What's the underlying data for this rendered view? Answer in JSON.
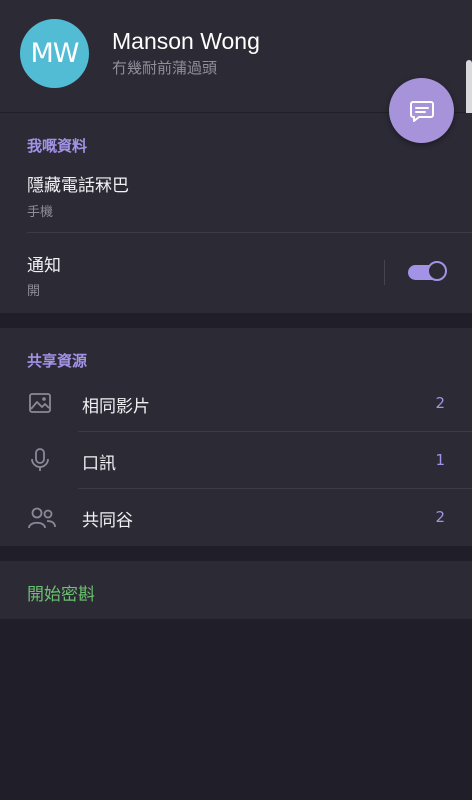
{
  "profile": {
    "initials": "MW",
    "name": "Manson Wong",
    "status": "冇幾耐前蒲過頭",
    "avatar_color": "#53bcd5"
  },
  "fab": {
    "icon": "message-icon",
    "color": "#a793d9"
  },
  "info": {
    "title": "我嘅資料",
    "phone": {
      "value": "隱藏電話冧巴",
      "label": "手機"
    },
    "notifications": {
      "label": "通知",
      "status": "開",
      "enabled": true
    }
  },
  "shared": {
    "title": "共享資源",
    "items": [
      {
        "label": "相同影片",
        "count": "2",
        "icon": "image-icon"
      },
      {
        "label": "口訊",
        "count": "1",
        "icon": "microphone-icon"
      },
      {
        "label": "共同谷",
        "count": "2",
        "icon": "group-icon"
      }
    ]
  },
  "secret_chat": {
    "label": "開始密斟",
    "color": "#6cc16f"
  },
  "accent_color": "#a393e6"
}
